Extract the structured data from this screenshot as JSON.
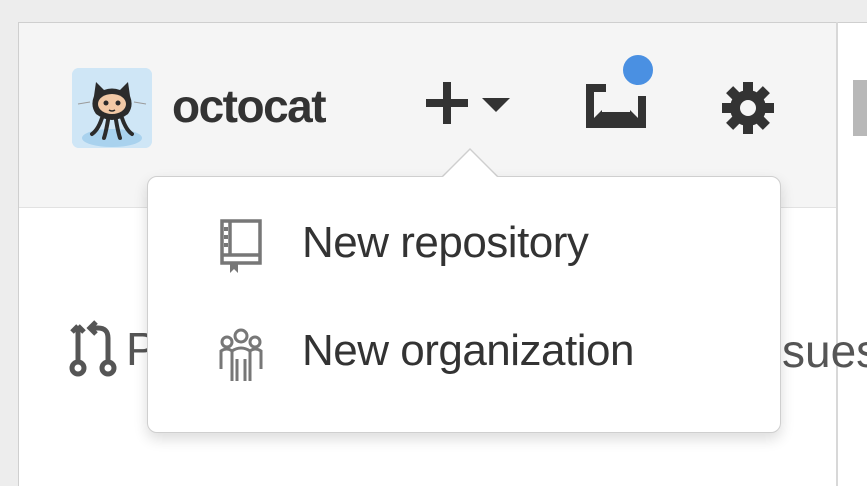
{
  "header": {
    "username": "octocat",
    "create_icon": "plus-icon",
    "inbox_icon": "inbox-icon",
    "settings_icon": "gear-icon"
  },
  "dropdown": {
    "items": [
      {
        "label": "New repository",
        "icon": "repo-icon"
      },
      {
        "label": "New organization",
        "icon": "organization-icon"
      }
    ]
  },
  "background": {
    "pull_requests_fragment": "P",
    "issues_fragment": "sues"
  },
  "colors": {
    "notification": "#4a90e2",
    "header_bg": "#f5f5f5",
    "text": "#333333"
  }
}
